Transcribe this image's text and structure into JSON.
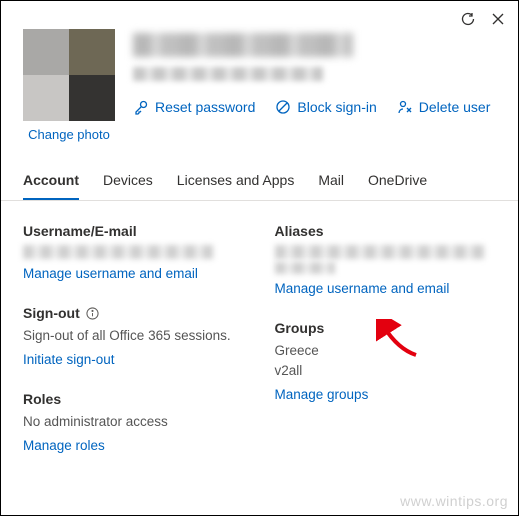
{
  "topbar": {
    "refresh": "refresh",
    "close": "close"
  },
  "header": {
    "change_photo": "Change photo",
    "actions": {
      "reset": "Reset password",
      "block": "Block sign-in",
      "delete": "Delete user"
    }
  },
  "tabs": {
    "account": "Account",
    "devices": "Devices",
    "licenses": "Licenses and Apps",
    "mail": "Mail",
    "onedrive": "OneDrive"
  },
  "left": {
    "username": {
      "title": "Username/E-mail",
      "link": "Manage username and email"
    },
    "signout": {
      "title": "Sign-out",
      "text": "Sign-out of all Office 365 sessions.",
      "link": "Initiate sign-out"
    },
    "roles": {
      "title": "Roles",
      "text": "No administrator access",
      "link": "Manage roles"
    }
  },
  "right": {
    "aliases": {
      "title": "Aliases",
      "link": "Manage username and email"
    },
    "groups": {
      "title": "Groups",
      "g1": "Greece",
      "g2": "v2all",
      "link": "Manage groups"
    }
  },
  "watermark": "www.wintips.org"
}
